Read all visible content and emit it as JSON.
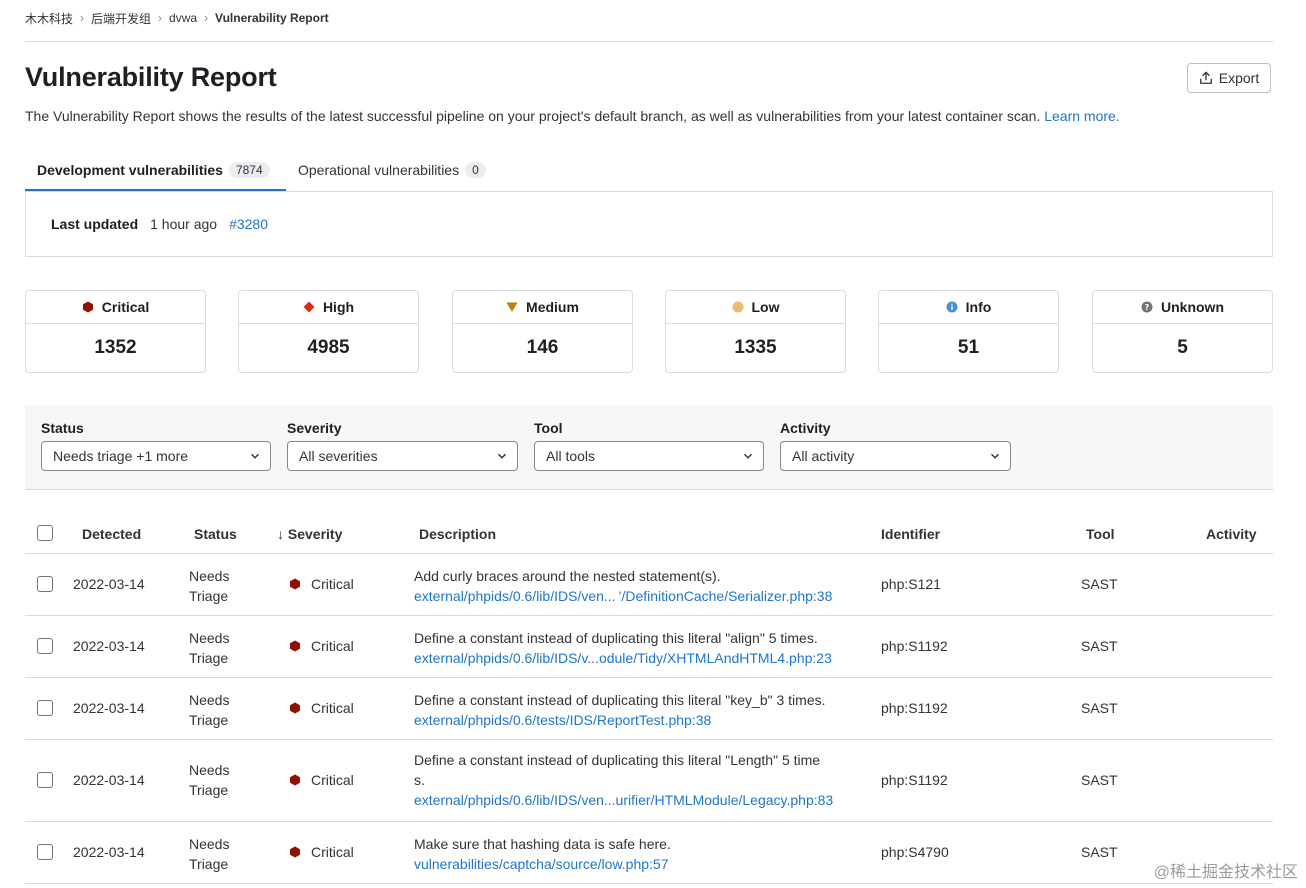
{
  "breadcrumb": [
    "木木科技",
    "后端开发组",
    "dvwa",
    "Vulnerability Report"
  ],
  "page": {
    "title": "Vulnerability Report",
    "export_label": "Export",
    "intro": "The Vulnerability Report shows the results of the latest successful pipeline on your project's default branch, as well as vulnerabilities from your latest container scan.",
    "learn_more": "Learn more."
  },
  "tabs": [
    {
      "label": "Development vulnerabilities",
      "count": "7874"
    },
    {
      "label": "Operational vulnerabilities",
      "count": "0"
    }
  ],
  "last_updated": {
    "label": "Last updated",
    "ago": "1 hour ago",
    "pipeline": "#3280"
  },
  "severity_cards": [
    {
      "name": "Critical",
      "count": "1352",
      "color": "#8d1300"
    },
    {
      "name": "High",
      "count": "4985",
      "color": "#dd2b0e"
    },
    {
      "name": "Medium",
      "count": "146",
      "color": "#c17d10"
    },
    {
      "name": "Low",
      "count": "1335",
      "color": "#e9be74"
    },
    {
      "name": "Info",
      "count": "51",
      "color": "#428fdc"
    },
    {
      "name": "Unknown",
      "count": "5",
      "color": "#737278"
    }
  ],
  "filters": [
    {
      "label": "Status",
      "value": "Needs triage +1 more"
    },
    {
      "label": "Severity",
      "value": "All severities"
    },
    {
      "label": "Tool",
      "value": "All tools"
    },
    {
      "label": "Activity",
      "value": "All activity"
    }
  ],
  "table": {
    "headers": {
      "detected": "Detected",
      "status": "Status",
      "severity": "↓ Severity",
      "description": "Description",
      "identifier": "Identifier",
      "tool": "Tool",
      "activity": "Activity"
    },
    "rows": [
      {
        "detected": "2022-03-14",
        "status_l1": "Needs",
        "status_l2": "Triage",
        "severity": "Critical",
        "description": [
          "Add curly braces around the nested statement(s)."
        ],
        "link": "external/phpids/0.6/lib/IDS/ven... ’/DefinitionCache/Serializer.php:38",
        "identifier": "php:S121",
        "tool": "SAST"
      },
      {
        "detected": "2022-03-14",
        "status_l1": "Needs",
        "status_l2": "Triage",
        "severity": "Critical",
        "description": [
          "Define a constant instead of duplicating this literal \"align\" 5 times."
        ],
        "link": "external/phpids/0.6/lib/IDS/v...odule/Tidy/XHTMLAndHTML4.php:23",
        "identifier": "php:S1192",
        "tool": "SAST"
      },
      {
        "detected": "2022-03-14",
        "status_l1": "Needs",
        "status_l2": "Triage",
        "severity": "Critical",
        "description": [
          "Define a constant instead of duplicating this literal \"key_b\" 3 times."
        ],
        "link": "external/phpids/0.6/tests/IDS/ReportTest.php:38",
        "identifier": "php:S1192",
        "tool": "SAST"
      },
      {
        "detected": "2022-03-14",
        "status_l1": "Needs",
        "status_l2": "Triage",
        "severity": "Critical",
        "description": [
          "Define a constant instead of duplicating this literal \"Length\" 5 time",
          "s."
        ],
        "link": "external/phpids/0.6/lib/IDS/ven...urifier/HTMLModule/Legacy.php:83",
        "identifier": "php:S1192",
        "tool": "SAST"
      },
      {
        "detected": "2022-03-14",
        "status_l1": "Needs",
        "status_l2": "Triage",
        "severity": "Critical",
        "description": [
          "Make sure that hashing data is safe here."
        ],
        "link": "vulnerabilities/captcha/source/low.php:57",
        "identifier": "php:S4790",
        "tool": "SAST"
      }
    ]
  },
  "watermark": "@稀土掘金技术社区"
}
